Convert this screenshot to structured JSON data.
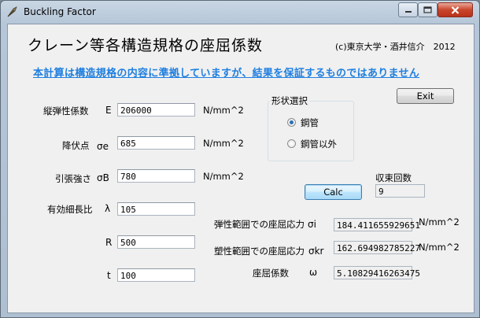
{
  "window": {
    "title": "Buckling Factor"
  },
  "header": {
    "heading": "クレーン等各構造規格の座屈係数",
    "copyright": "(c)東京大学・酒井信介　2012",
    "disclaimer": "本計算は構造規格の内容に準拠していますが、結果を保証するものではありません"
  },
  "buttons": {
    "exit": "Exit",
    "calc": "Calc"
  },
  "inputs": [
    {
      "label": "縦弾性係数",
      "symbol": "E",
      "value": "206000",
      "unit": "N/mm^2"
    },
    {
      "label": "降伏点",
      "symbol": "σe",
      "value": "685",
      "unit": "N/mm^2"
    },
    {
      "label": "引張強さ",
      "symbol": "σB",
      "value": "780",
      "unit": "N/mm^2"
    },
    {
      "label": "有効細長比",
      "symbol": "λ",
      "value": "105"
    },
    {
      "label": "",
      "symbol": "R",
      "value": "500"
    },
    {
      "label": "",
      "symbol": "t",
      "value": "100"
    }
  ],
  "shape": {
    "group_label": "形状選択",
    "options": [
      {
        "label": "鋼管",
        "selected": true
      },
      {
        "label": "鋼管以外",
        "selected": false
      }
    ]
  },
  "convergence": {
    "label": "収束回数",
    "value": "9"
  },
  "results": [
    {
      "label": "弾性範囲での座屈応力",
      "symbol": "σi",
      "value": "184.411655929651",
      "unit": "N/mm^2"
    },
    {
      "label": "塑性範囲での座屈応力",
      "symbol": "σkr",
      "value": "162.694982785227",
      "unit": "N/mm^2"
    },
    {
      "label": "座屈係数",
      "symbol": "ω",
      "value": "5.10829416263475"
    }
  ]
}
